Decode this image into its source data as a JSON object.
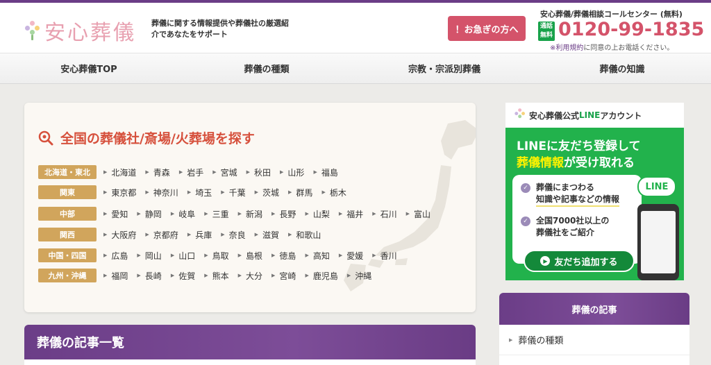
{
  "header": {
    "logo_text": "安心葬儀",
    "tagline": "葬儀に関する情報提供や葬儀社の厳選紹介であなたをサポート",
    "urgent_button": "！お急ぎの方へ",
    "callcenter_label": "安心葬儀/葬儀相談コールセンター (無料)",
    "free_badge": "通話無料",
    "phone": "0120-99-1835",
    "phone_note_link": "※利用規約",
    "phone_note_rest": "に同意の上お電話ください。"
  },
  "nav": {
    "items": [
      "安心葬儀TOP",
      "葬儀の種類",
      "宗教・宗派別葬儀",
      "葬儀の知識"
    ]
  },
  "search": {
    "title": "全国の葬儀社/斎場/火葬場を探す",
    "regions": [
      {
        "name": "北海道・東北",
        "prefs": [
          "北海道",
          "青森",
          "岩手",
          "宮城",
          "秋田",
          "山形",
          "福島"
        ]
      },
      {
        "name": "関東",
        "prefs": [
          "東京都",
          "神奈川",
          "埼玉",
          "千葉",
          "茨城",
          "群馬",
          "栃木"
        ]
      },
      {
        "name": "中部",
        "prefs": [
          "愛知",
          "静岡",
          "岐阜",
          "三重",
          "新潟",
          "長野",
          "山梨",
          "福井",
          "石川",
          "富山"
        ]
      },
      {
        "name": "関西",
        "prefs": [
          "大阪府",
          "京都府",
          "兵庫",
          "奈良",
          "滋賀",
          "和歌山"
        ]
      },
      {
        "name": "中国・四国",
        "prefs": [
          "広島",
          "岡山",
          "山口",
          "鳥取",
          "島根",
          "徳島",
          "高知",
          "愛媛",
          "香川"
        ]
      },
      {
        "name": "九州・沖縄",
        "prefs": [
          "福岡",
          "長崎",
          "佐賀",
          "熊本",
          "大分",
          "宮崎",
          "鹿児島",
          "沖縄"
        ]
      }
    ]
  },
  "articles": {
    "title": "葬儀の記事一覧"
  },
  "line_banner": {
    "header_prefix": "安心葬儀公式",
    "header_line": "LINE",
    "header_suffix": "アカウント",
    "headline1": "LINEに友だち登録して",
    "headline2_highlight": "葬儀情報",
    "headline2_rest": "が受け取れる",
    "item1_line1": "葬儀にまつわる",
    "item1_line2": "知識や記事などの情報",
    "item2_line1": "全国7000社以上の",
    "item2_line2": "葬儀社をご紹介",
    "button": "友だち追加する",
    "bubble": "LINE"
  },
  "sidebar": {
    "title": "葬儀の記事",
    "items": [
      "葬儀の種類"
    ]
  },
  "colors": {
    "brand_purple": "#6b3d87",
    "accent_pink": "#d4536a",
    "search_title_red": "#d6503c",
    "region_tag_gold": "#d1a55c",
    "line_green": "#22b24c"
  }
}
